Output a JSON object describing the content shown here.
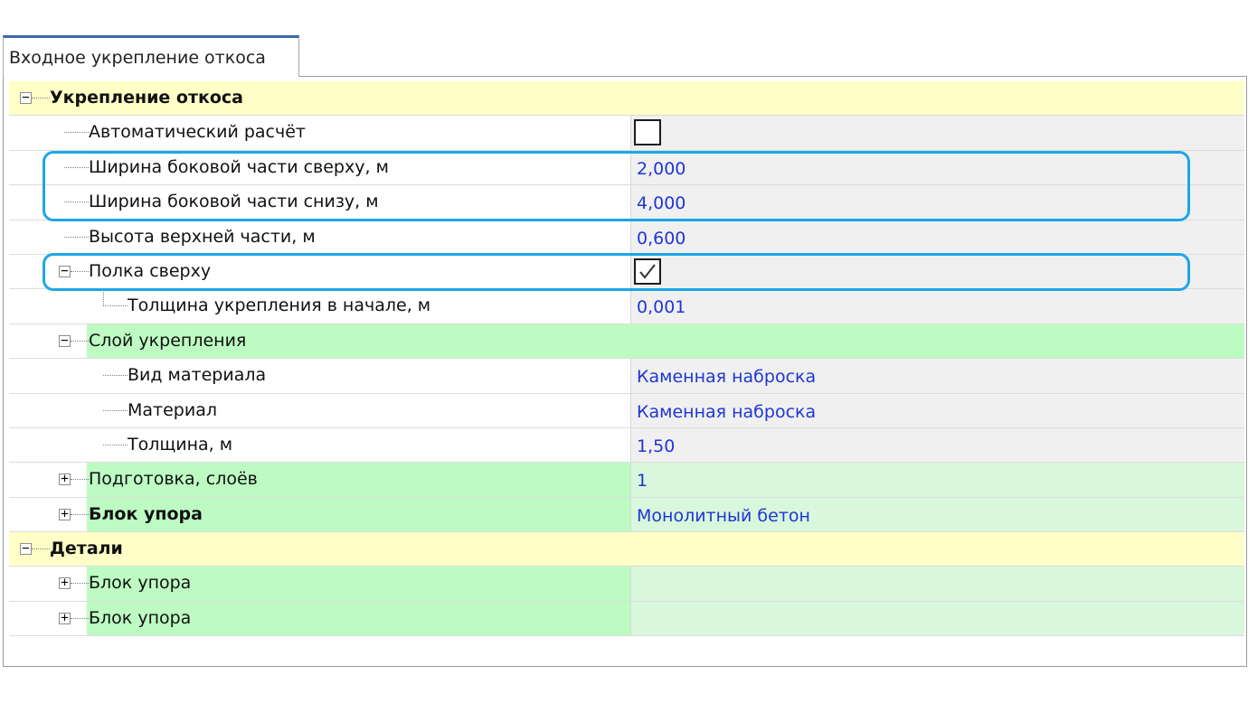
{
  "tab": {
    "label": "Входное укрепление откоса"
  },
  "sections": [
    {
      "label": "Укрепление откоса"
    },
    {
      "label": "Детали"
    }
  ],
  "rows": {
    "auto_calc": {
      "label": "Автоматический расчёт",
      "checked": false
    },
    "width_top": {
      "label": "Ширина боковой части сверху, м",
      "value": "2,000"
    },
    "width_bottom": {
      "label": "Ширина боковой части снизу, м",
      "value": "4,000"
    },
    "height_top": {
      "label": "Высота верхней части, м",
      "value": "0,600"
    },
    "shelf_top": {
      "label": "Полка сверху",
      "checked": true
    },
    "thickness_start": {
      "label": "Толщина укрепления в начале, м",
      "value": "0,001"
    },
    "layer": {
      "label": "Слой укрепления"
    },
    "material_type": {
      "label": "Вид материала",
      "value": "Каменная наброска"
    },
    "material": {
      "label": "Материал",
      "value": "Каменная наброска"
    },
    "thickness": {
      "label": "Толщина, м",
      "value": "1,50"
    },
    "prep_layers": {
      "label": "Подготовка, слоёв",
      "value": "1"
    },
    "stop_block": {
      "label": "Блок упора",
      "value": "Монолитный бетон"
    },
    "detail_block_1": {
      "label": "Блок упора",
      "value": ""
    },
    "detail_block_2": {
      "label": "Блок упора",
      "value": ""
    }
  },
  "expander_glyphs": {
    "expanded": "−",
    "collapsed": "+"
  },
  "colors": {
    "category": "#ffffc7",
    "group_name": "#bdfbc2",
    "group_value": "#d9f7dc",
    "value_text": "#1f36d6",
    "highlight": "#1ba7e6",
    "tab_accent": "#3a67b0"
  }
}
